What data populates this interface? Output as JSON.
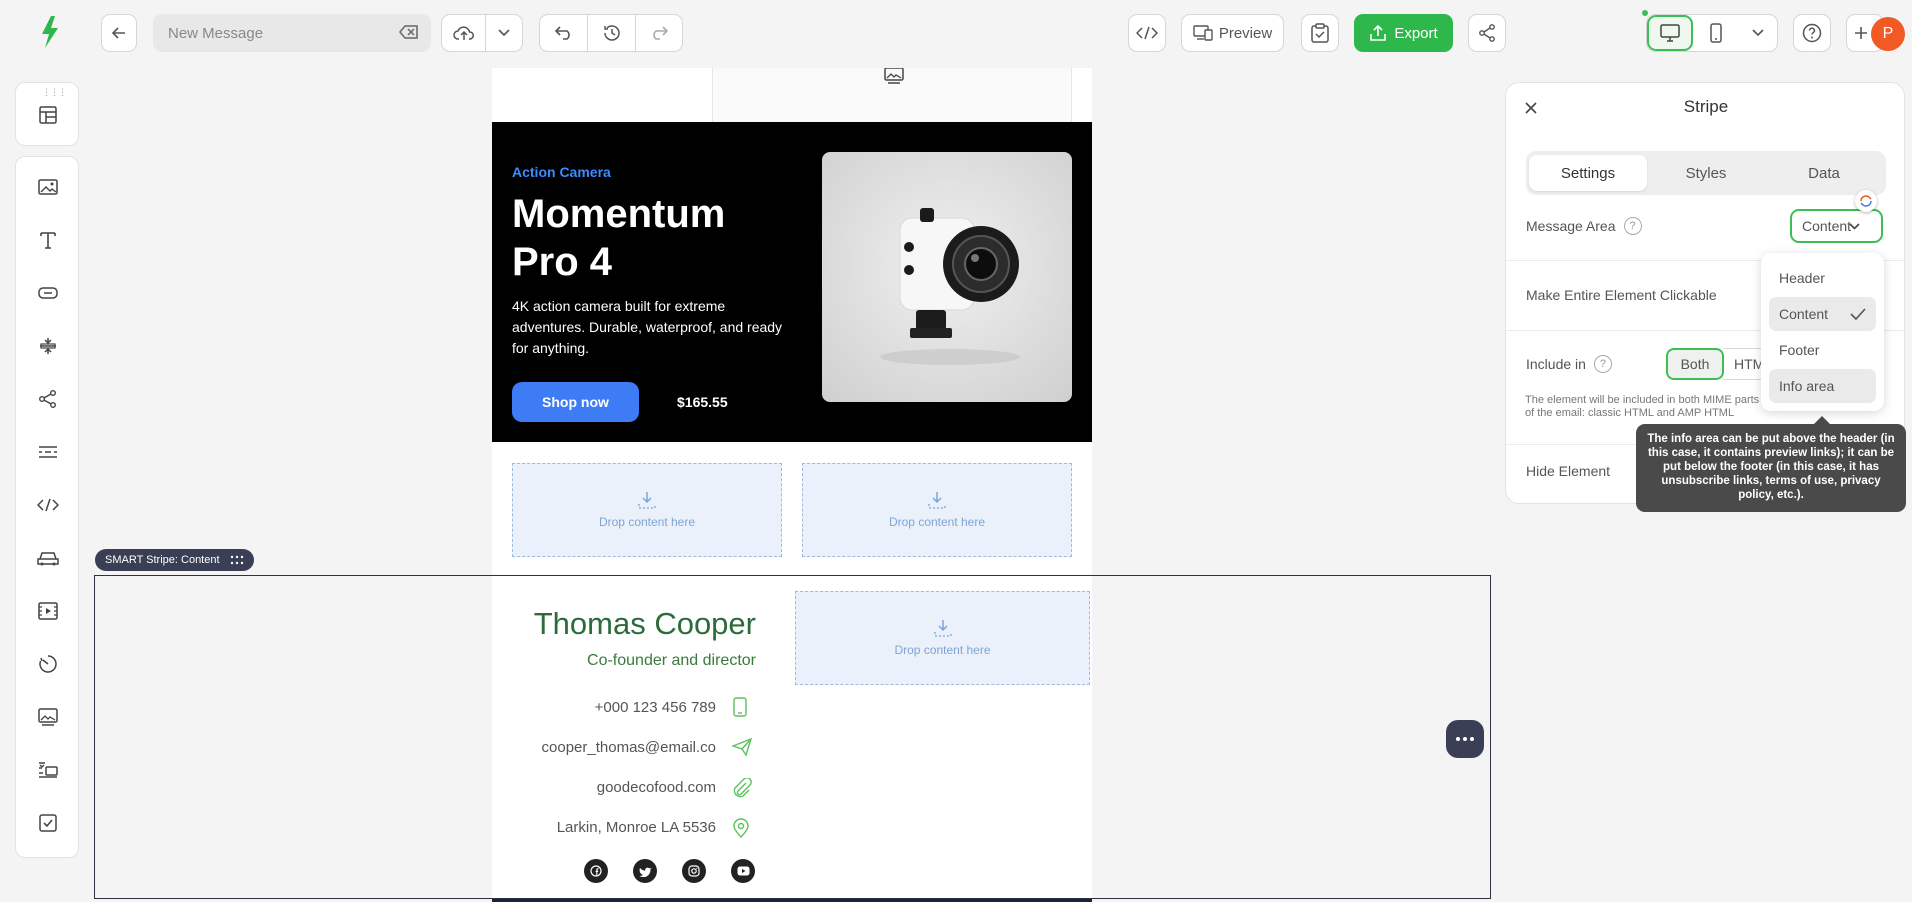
{
  "topbar": {
    "message_placeholder": "New Message",
    "preview_label": "Preview",
    "export_label": "Export",
    "avatar_initial": "P"
  },
  "email": {
    "hero": {
      "eyebrow": "Action Camera",
      "title": "Momentum Pro 4",
      "description": "4K action camera built for extreme adventures. Durable, waterproof, and ready for anything.",
      "cta_label": "Shop now",
      "price": "$165.55"
    },
    "dropzone_label": "Drop content here",
    "signature": {
      "name": "Thomas Cooper",
      "role": "Co-founder and director",
      "phone": "+000 123 456 789",
      "email": "cooper_thomas@email.co",
      "website": "goodecofood.com",
      "address": "Larkin, Monroe LA 5536"
    }
  },
  "stripe_tag": "SMART Stripe: Content",
  "panel": {
    "title": "Stripe",
    "tabs": [
      "Settings",
      "Styles",
      "Data"
    ],
    "message_area_label": "Message Area",
    "message_area_value": "Content",
    "clickable_label": "Make Entire Element Clickable",
    "include_label": "Include in",
    "include_options": [
      "Both",
      "HTML"
    ],
    "include_note": "The element will be included in both MIME parts of the email: classic HTML and AMP HTML",
    "hide_label": "Hide Element"
  },
  "dropdown": {
    "options": [
      "Header",
      "Content",
      "Footer",
      "Info area"
    ],
    "selected": "Content"
  },
  "tooltip": "The info area can be put above the header (in this case, it contains preview links); it can be put below the footer (in this case, it has unsubscribe links, terms of use, privacy policy, etc.).",
  "colors": {
    "accent_green": "#3bbf55",
    "export_green": "#2eb84b",
    "hero_blue": "#3d7cf5",
    "signature_green": "#2c6b3a",
    "avatar_orange": "#f15a24"
  }
}
